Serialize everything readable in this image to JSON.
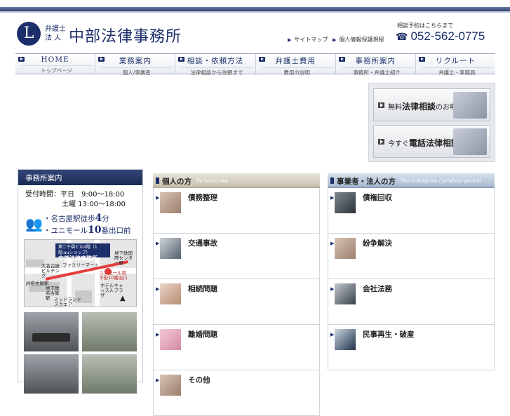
{
  "header": {
    "logo_mark": "L",
    "logo_small": "弁護士法 人",
    "logo_name": "中部法律事務所",
    "links": [
      {
        "label": "サイトマップ"
      },
      {
        "label": "個人情報保護規程"
      }
    ],
    "tel_note": "相談予約はこちらまで",
    "tel": "052-562-0775"
  },
  "nav": [
    {
      "main": "HOME",
      "sub": "トップページ"
    },
    {
      "main": "業務案内",
      "sub": "個人/事業者"
    },
    {
      "main": "相談・依頼方法",
      "sub": "法律相談から依頼まで"
    },
    {
      "main": "弁護士費用",
      "sub": "費用の説明"
    },
    {
      "main": "事務所案内",
      "sub": "事務所・弁護士紹介"
    },
    {
      "main": "リクルート",
      "sub": "弁護士・事務員"
    }
  ],
  "banners": {
    "free_pre": "無料",
    "free_main": "法律相談",
    "free_post": "のお申込み",
    "phone_pre": "今すぐ",
    "phone_main": "電話法律相談"
  },
  "sidebar": {
    "title": "事務所案内",
    "hours_1": "受付時間：平日　9:00～18:00",
    "hours_2": "土曜 13:00～18:00",
    "access_1_pre": "・名古屋駅徒歩",
    "access_1_num": "4",
    "access_1_post": "分",
    "access_2_pre": "・ユニモール",
    "access_2_num": "10",
    "access_2_post": "番出口前",
    "map": {
      "callout_1": "第二千福ビル9階（1階:auショップ）",
      "callout_2": "中部法律事務所",
      "labels": [
        "ファミリーマート",
        "大名古屋ビルヂング",
        "JR名古屋駅",
        "ユニモール地下街10番出口",
        "ホテルキャッスルプラザ",
        "ミッドランドスクエア",
        "地下鉄国際センター駅",
        "地下鉄名古屋駅"
      ]
    }
  },
  "personal": {
    "title": "個人の方",
    "subtitle": "Personal one",
    "items": [
      "債務整理",
      "交通事故",
      "相続問題",
      "離婚問題",
      "その他"
    ]
  },
  "business": {
    "title": "事業者・法人の方",
    "subtitle": "The enterprise / juridical person",
    "items": [
      "債権回収",
      "紛争解決",
      "会社法務",
      "民事再生・破産"
    ]
  }
}
